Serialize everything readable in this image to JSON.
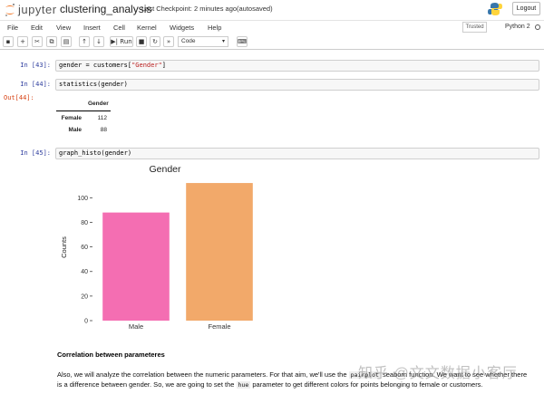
{
  "header": {
    "brand": "jupyter",
    "notebook_name": "clustering_analysis",
    "checkpoint": "Last Checkpoint: 2 minutes ago",
    "autosave_status": "(autosaved)",
    "logout_label": "Logout"
  },
  "menu": {
    "items": [
      "File",
      "Edit",
      "View",
      "Insert",
      "Cell",
      "Kernel",
      "Widgets",
      "Help"
    ],
    "trusted_label": "Trusted",
    "kernel_name": "Python 2"
  },
  "toolbar": {
    "run_label": "Run",
    "cell_type": "Code"
  },
  "cells": [
    {
      "prompt": "In [43]:",
      "code_pre": "gender = customers[",
      "code_str": "\"Gender\"",
      "code_post": "]"
    },
    {
      "prompt": "In [44]:",
      "code": "statistics(gender)"
    },
    {
      "prompt": "Out[44]:"
    },
    {
      "prompt": "In [45]:",
      "code": "graph_histo(gender)"
    }
  ],
  "dataframe": {
    "column": "Gender",
    "rows": [
      {
        "index": "Female",
        "value": "112"
      },
      {
        "index": "Male",
        "value": "88"
      }
    ]
  },
  "chart_data": {
    "type": "bar",
    "title": "Gender",
    "xlabel": "",
    "ylabel": "Counts",
    "categories": [
      "Male",
      "Female"
    ],
    "values": [
      88,
      112
    ],
    "colors": [
      "#f46eb2",
      "#f2a96a"
    ],
    "ylim": [
      0,
      115
    ],
    "yticks": [
      0,
      20,
      40,
      60,
      80,
      100
    ],
    "grid": false
  },
  "markdown": {
    "heading": "Correlation between parameteres",
    "p1_a": "Also, we will analyze the correlation between the numeric parameters. For that aim, we'll use the",
    "p1_code": "pairplot",
    "p1_b": "seaborn function. We want to see whether there",
    "p2_a": "is a difference between gender. So, we are going to set the",
    "p2_code": "hue",
    "p2_b": "parameter to get different colors for points belonging to female or customers."
  },
  "watermark": "知乎 @文文数据小客厅"
}
